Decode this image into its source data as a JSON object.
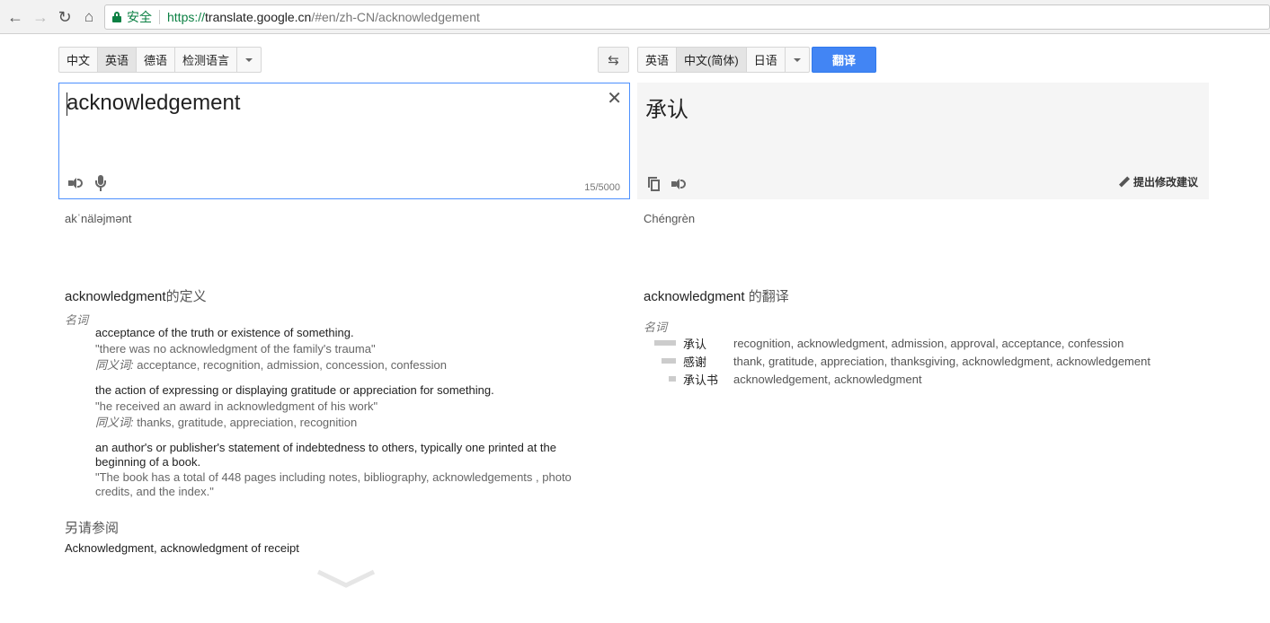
{
  "browser": {
    "secure_label": "安全",
    "url_scheme": "https://",
    "url_host": "translate.google.cn",
    "url_path": "/#en/zh-CN/acknowledgement"
  },
  "source_langs": {
    "items": [
      "中文",
      "英语",
      "德语",
      "检测语言"
    ],
    "active_index": 1
  },
  "target_langs": {
    "items": [
      "英语",
      "中文(简体)",
      "日语"
    ],
    "active_index": 1
  },
  "translate_button": "翻译",
  "source": {
    "text": "acknowledgement",
    "char_count": "15/5000",
    "transliteration": "akˈnäləjmənt"
  },
  "target": {
    "text": "承认",
    "suggest_label": "提出修改建议",
    "transliteration": "Chéngrèn"
  },
  "definitions": {
    "word": "acknowledgment",
    "title_suffix": "的定义",
    "pos": "名词",
    "entries": [
      {
        "text": "acceptance of the truth or existence of something.",
        "example": "\"there was no acknowledgment of the family's trauma\"",
        "syn_label": "同义词:",
        "synonyms": "acceptance, recognition, admission, concession, confession"
      },
      {
        "text": "the action of expressing or displaying gratitude or appreciation for something.",
        "example": "\"he received an award in acknowledgment of his work\"",
        "syn_label": "同义词:",
        "synonyms": "thanks, gratitude, appreciation, recognition"
      },
      {
        "text": "an author's or publisher's statement of indebtedness to others, typically one printed at the beginning of a book.",
        "example": "\"The book has a total of 448 pages including notes, bibliography, acknowledgements , photo credits, and the index.\""
      }
    ],
    "see_also_title": "另请参阅",
    "see_also": "Acknowledgment, acknowledgment of receipt"
  },
  "translations": {
    "word": "acknowledgment",
    "title_suffix": " 的翻译",
    "pos": "名词",
    "rows": [
      {
        "word": "承认",
        "frequency": 1.0,
        "list": "recognition, acknowledgment, admission, approval, acceptance, confession"
      },
      {
        "word": "感谢",
        "frequency": 0.66,
        "list": "thank, gratitude, appreciation, thanksgiving, acknowledgment, acknowledgement"
      },
      {
        "word": "承认书",
        "frequency": 0.33,
        "list": "acknowledgement, acknowledgment"
      }
    ]
  },
  "icons": {
    "back": "back-arrow-icon",
    "forward": "forward-arrow-icon",
    "reload": "reload-icon",
    "home": "home-icon",
    "lock": "lock-icon",
    "swap": "swap-icon",
    "clear": "close-icon",
    "speaker": "speaker-icon",
    "mic": "microphone-icon",
    "copy": "copy-icon",
    "pencil": "pencil-icon",
    "chevron": "chevron-down-icon"
  },
  "colors": {
    "accent": "#4285f4",
    "secure": "#0b8043"
  }
}
